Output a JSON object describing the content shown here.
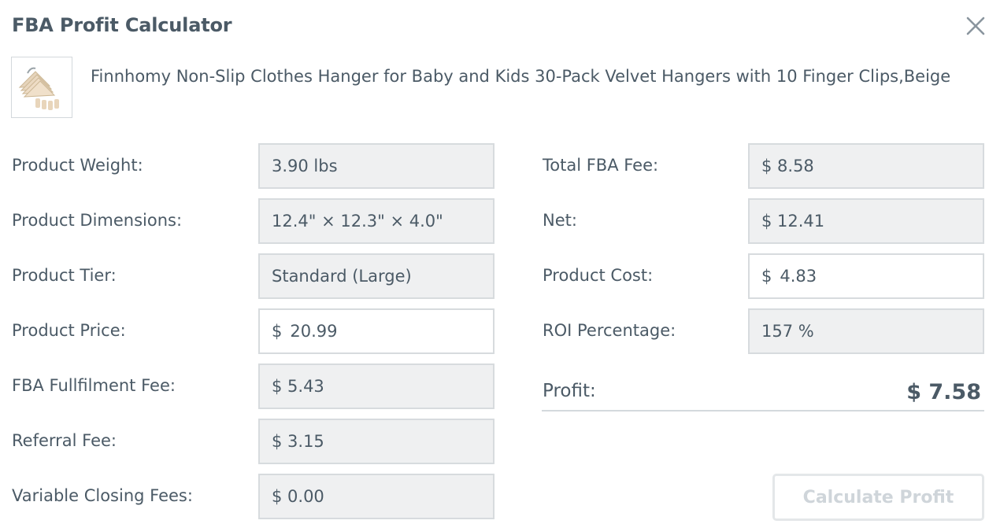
{
  "dialog": {
    "title": "FBA Profit Calculator"
  },
  "product": {
    "name": "Finnhomy Non-Slip Clothes Hanger for Baby and Kids 30-Pack Velvet Hangers with 10 Finger Clips,Beige",
    "thumbnail_icon": "hanger-product-image"
  },
  "left": {
    "weight": {
      "label": "Product Weight:",
      "value": "3.90 lbs"
    },
    "dimensions": {
      "label": "Product Dimensions:",
      "value": "12.4\" × 12.3\" × 4.0\""
    },
    "tier": {
      "label": "Product Tier:",
      "value": "Standard (Large)"
    },
    "price": {
      "label": "Product Price:",
      "currency": "$",
      "value": "20.99"
    },
    "fulfilment": {
      "label": "FBA Fullfilment Fee:",
      "value": "$ 5.43"
    },
    "referral": {
      "label": "Referral Fee:",
      "value": "$ 3.15"
    },
    "closing": {
      "label": "Variable Closing Fees:",
      "value": "$ 0.00"
    }
  },
  "right": {
    "total_fba": {
      "label": "Total FBA Fee:",
      "value": "$ 8.58"
    },
    "net": {
      "label": "Net:",
      "value": "$ 12.41"
    },
    "cost": {
      "label": "Product Cost:",
      "currency": "$",
      "value": "4.83"
    },
    "roi": {
      "label": "ROI Percentage:",
      "value": "157 %"
    }
  },
  "profit": {
    "label": "Profit:",
    "value": "$ 7.58"
  },
  "actions": {
    "calculate_label": "Calculate Profit"
  },
  "colors": {
    "text": "#4b5a66",
    "field_bg": "#eff0f1",
    "field_border": "#d7dbde",
    "button_disabled_text": "#cfd5da"
  }
}
